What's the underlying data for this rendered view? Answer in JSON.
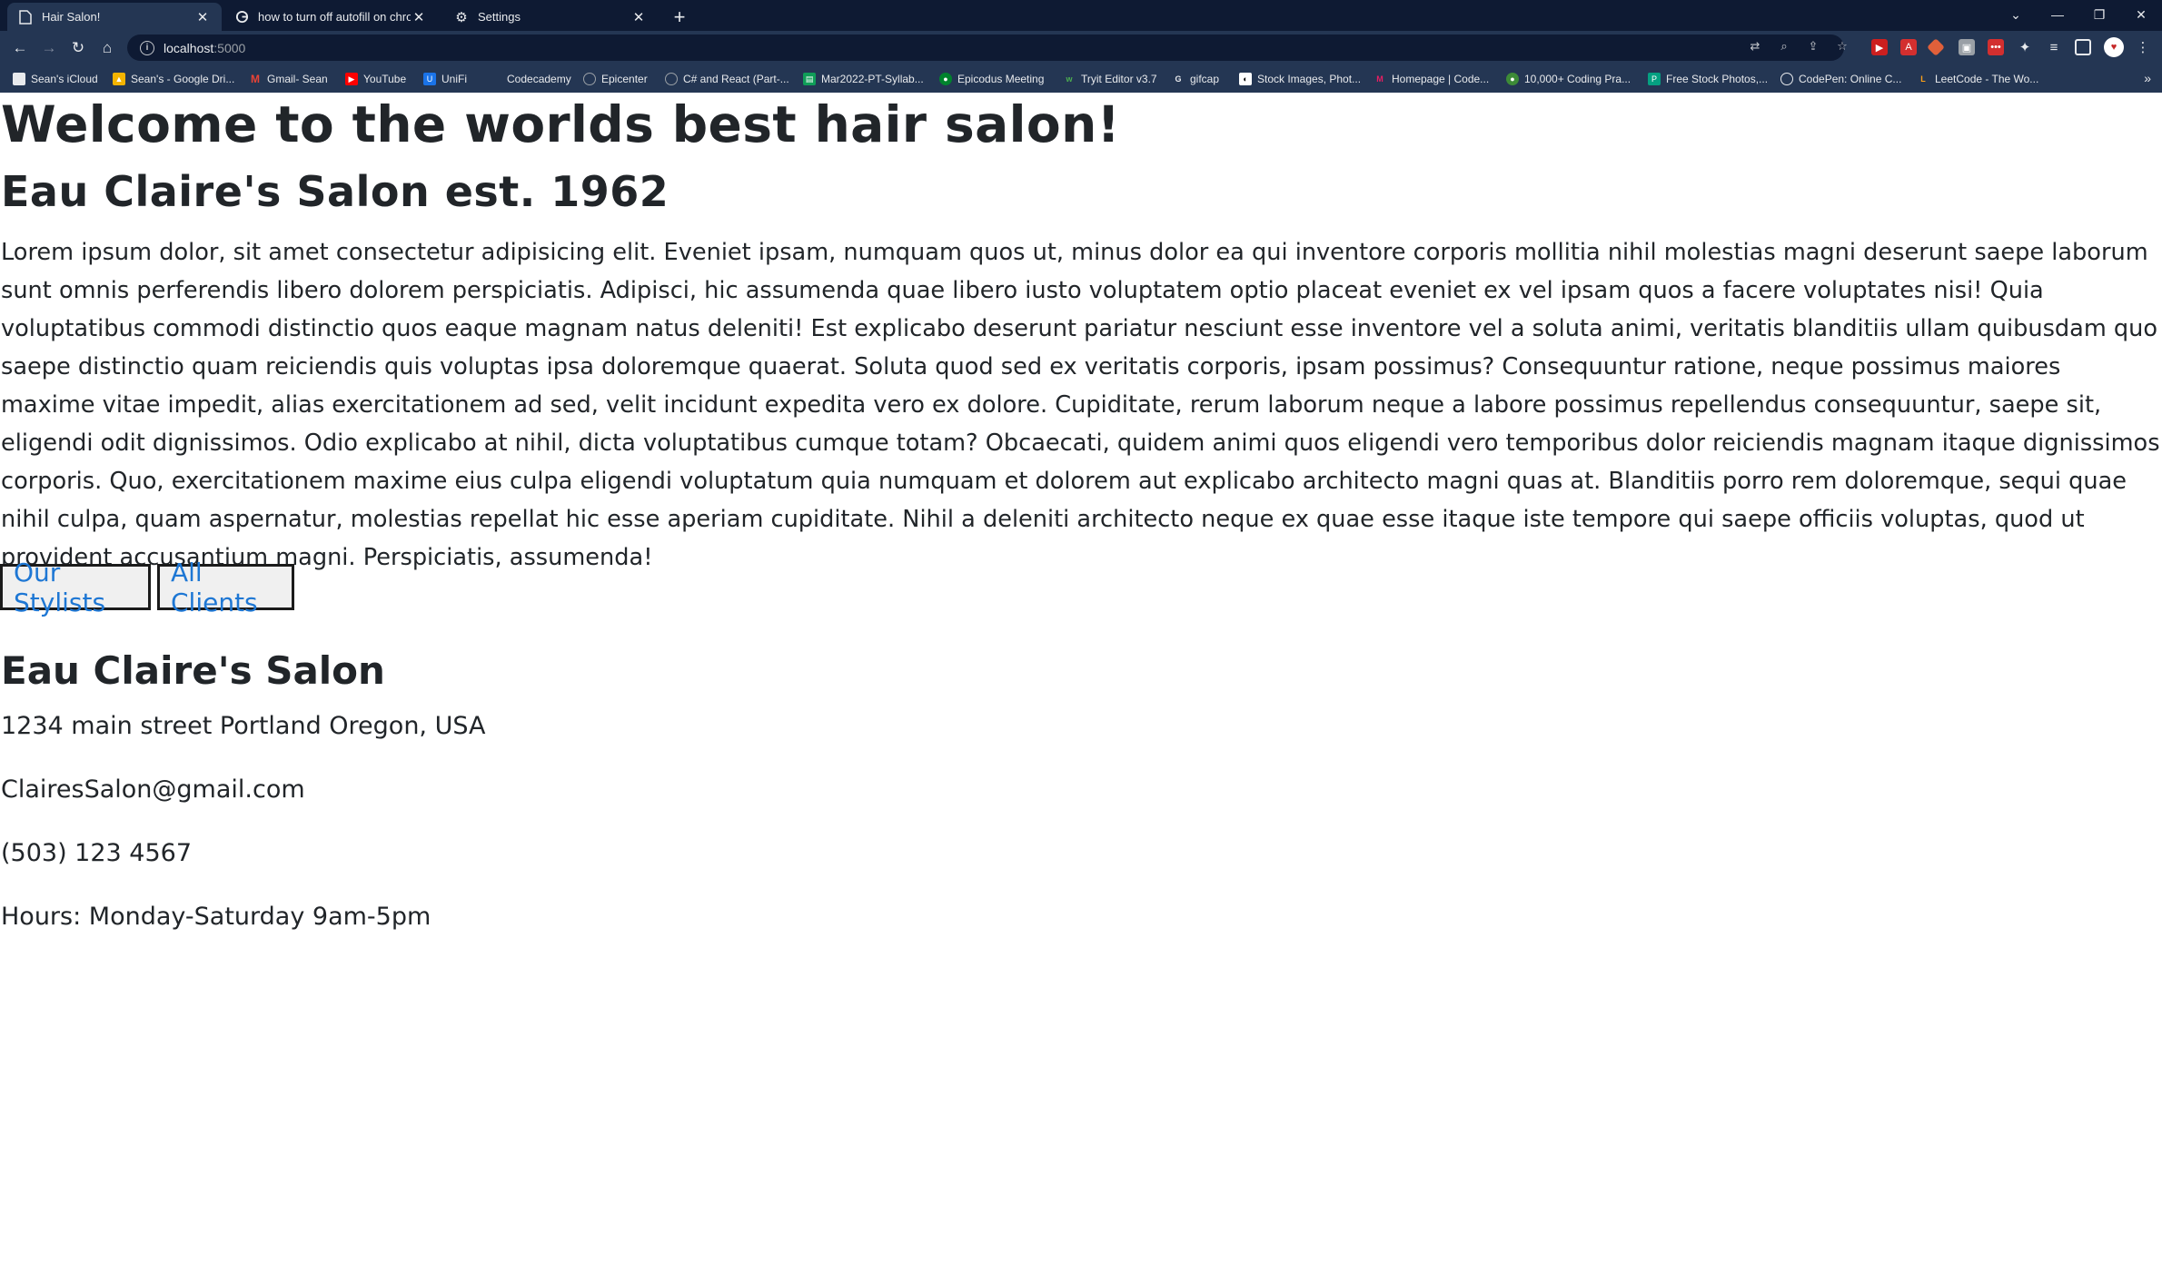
{
  "browser": {
    "tabs": [
      {
        "title": "Hair Salon!",
        "active": true,
        "icon": "page-icon"
      },
      {
        "title": "how to turn off autofill on chrom",
        "active": false,
        "icon": "google-icon"
      },
      {
        "title": "Settings",
        "active": false,
        "icon": "gear-icon"
      }
    ],
    "url": {
      "host": "localhost",
      "port": ":5000"
    },
    "bookmarks": [
      "Sean's iCloud",
      "Sean's - Google Dri...",
      "Gmail- Sean",
      "YouTube",
      "UniFi",
      "Codecademy",
      "Epicenter",
      "C# and React (Part-...",
      "Mar2022-PT-Syllab...",
      "Epicodus Meeting",
      "Tryit Editor v3.7",
      "gifcap",
      "Stock Images, Phot...",
      "Homepage | Code...",
      "10,000+ Coding Pra...",
      "Free Stock Photos,...",
      "CodePen: Online C...",
      "LeetCode - The Wo..."
    ],
    "colors": {
      "frame": "#0e1a33",
      "toolbar": "#243653"
    }
  },
  "page": {
    "heading": "Welcome to the worlds best hair salon!",
    "subheading": "Eau Claire's Salon est. 1962",
    "paragraph": "Lorem ipsum dolor, sit amet consectetur adipisicing elit. Eveniet ipsam, numquam quos ut, minus dolor ea qui inventore corporis mollitia nihil molestias magni deserunt saepe laborum sunt omnis perferendis libero dolorem perspiciatis. Adipisci, hic assumenda quae libero iusto voluptatem optio placeat eveniet ex vel ipsam quos a facere voluptates nisi! Quia voluptatibus commodi distinctio quos eaque magnam natus deleniti! Est explicabo deserunt pariatur nesciunt esse inventore vel a soluta animi, veritatis blanditiis ullam quibusdam quo saepe distinctio quam reiciendis quis voluptas ipsa doloremque quaerat. Soluta quod sed ex veritatis corporis, ipsam possimus? Consequuntur ratione, neque possimus maiores maxime vitae impedit, alias exercitationem ad sed, velit incidunt expedita vero ex dolore. Cupiditate, rerum laborum neque a labore possimus repellendus consequuntur, saepe sit, eligendi odit dignissimos. Odio explicabo at nihil, dicta voluptatibus cumque totam? Obcaecati, quidem animi quos eligendi vero temporibus dolor reiciendis magnam itaque dignissimos corporis. Quo, exercitationem maxime eius culpa eligendi voluptatum quia numquam et dolorem aut explicabo architecto magni quas at. Blanditiis porro rem doloremque, sequi quae nihil culpa, quam aspernatur, molestias repellat hic esse aperiam cupiditate. Nihil a deleniti architecto neque ex quae esse itaque iste tempore qui saepe officiis voluptas, quod ut provident accusantium magni. Perspiciatis, assumenda!",
    "buttons": {
      "stylists": "Our Stylists",
      "clients": "All Clients"
    },
    "salon": {
      "name": "Eau Claire's Salon",
      "address": "1234 main street Portland Oregon, USA",
      "email": "ClairesSalon@gmail.com",
      "phone": "(503) 123 4567",
      "hours": "Hours: Monday-Saturday 9am-5pm"
    },
    "colors": {
      "link": "#1e77d4",
      "text": "#212529"
    }
  }
}
